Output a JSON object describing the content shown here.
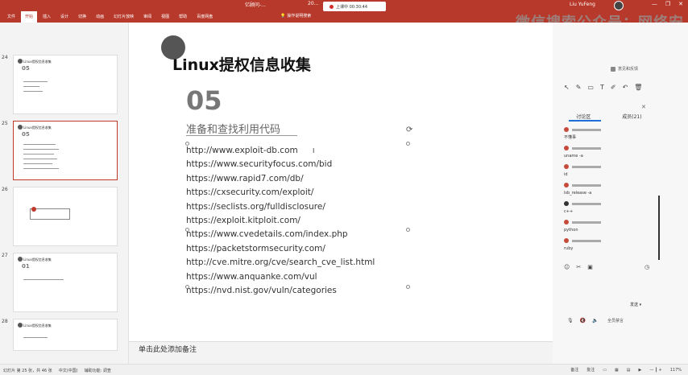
{
  "titlebar": {
    "doc_title": "亿顾问-...",
    "doc_title2": "20...",
    "recording": "上课中 00:30:44",
    "user": "Liu YuFeng",
    "search": "操作说明搜索",
    "controls": [
      "—",
      "❐",
      "✕"
    ],
    "watermark": "微信搜索公众号：网络安全"
  },
  "ribbon": {
    "tabs": [
      "文件",
      "开始",
      "插入",
      "设计",
      "切换",
      "动画",
      "幻灯片放映",
      "审阅",
      "视图",
      "帮助",
      "百度网盘"
    ],
    "active_index": 1
  },
  "thumbnails": [
    {
      "num": "24",
      "title": "Linux提权信息收集",
      "big": "05"
    },
    {
      "num": "25",
      "title": "Linux提权信息收集",
      "big": "05"
    },
    {
      "num": "26",
      "title": "",
      "big": ""
    },
    {
      "num": "27",
      "title": "Linux提权信息收集",
      "big": "01"
    },
    {
      "num": "28",
      "title": "Linux提权信息收集",
      "big": ""
    }
  ],
  "slide": {
    "title": "Linux提权信息收集",
    "section_number": "05",
    "section_title": "准备和查找利用代码",
    "urls": [
      "http://www.exploit-db.com",
      "https://www.securityfocus.com/bid",
      "https://www.rapid7.com/db/",
      "https://cxsecurity.com/exploit/",
      "https://seclists.org/fulldisclosure/",
      "https://exploit.kitploit.com/",
      "https://www.cvedetails.com/index.php",
      "https://packetstormsecurity.com/",
      "http://cve.mitre.org/cve/search_cve_list.html",
      "https://www.anquanke.com/vul",
      "https://nvd.nist.gov/vuln/categories"
    ]
  },
  "notes": {
    "placeholder": "单击此处添加备注"
  },
  "side_panel": {
    "feedback": "意见和反馈",
    "tabs": [
      "讨论区",
      "成员(21)"
    ],
    "active_tab": 0,
    "messages": [
      {
        "text": "不懂事"
      },
      {
        "text": "uname -a"
      },
      {
        "text": "id"
      },
      {
        "text": "lsb_release -a"
      },
      {
        "text": "c++"
      },
      {
        "text": "python"
      },
      {
        "text": "ruby"
      }
    ],
    "send_label": "发送 ▾",
    "bottom_text": "全员禁言"
  },
  "statusbar": {
    "left": [
      "幻灯片 第 25 张，共 46 张",
      "中文(中国)",
      "辅助功能: 调查"
    ],
    "notes_label": "备注",
    "comments_label": "批注",
    "zoom": "117%"
  }
}
